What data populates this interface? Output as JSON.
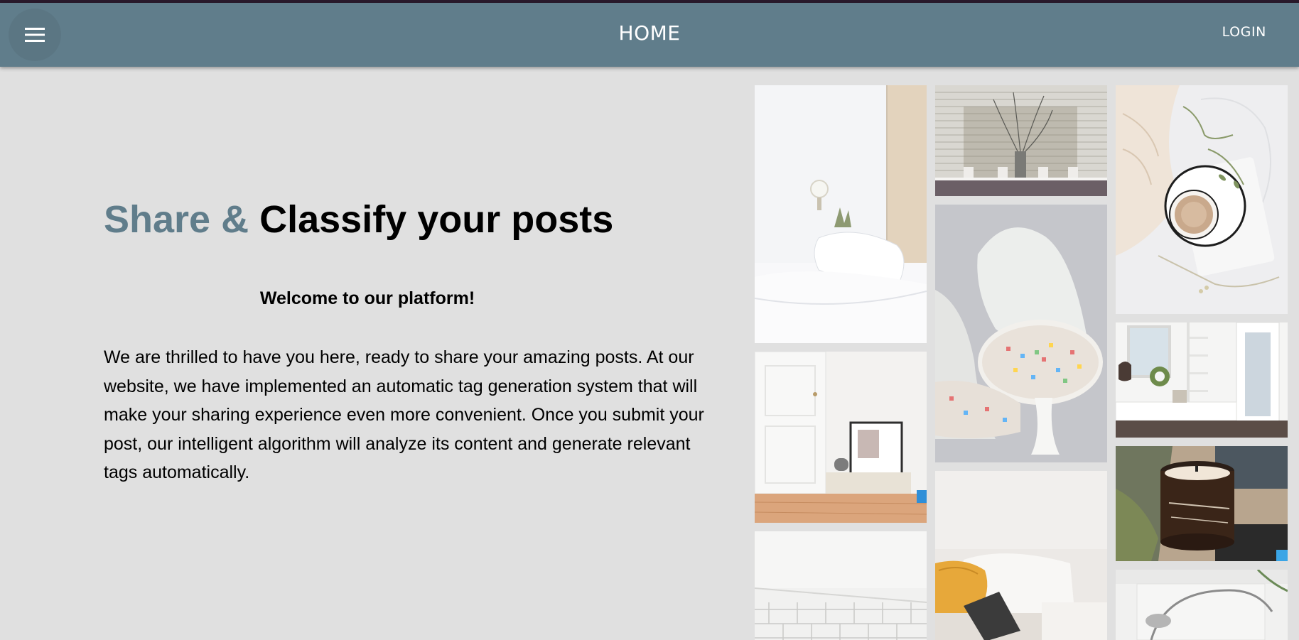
{
  "appbar": {
    "title": "HOME",
    "login_label": "LOGIN",
    "menu_icon": "menu-icon",
    "color": "#607d8b"
  },
  "hero": {
    "title_accent": "Share &",
    "title_rest": " Classify your posts",
    "accent_color": "#607d8b",
    "welcome": "Welcome to our platform!",
    "description": "We are thrilled to have you here, ready to share your amazing posts. At our website, we have implemented an automatic tag generation system that will make your sharing experience even more convenient. Once you submit your post, our intelligent algorithm will analyze its content and generate relevant tags automatically."
  },
  "gallery": {
    "images": [
      {
        "name": "bedroom-photo"
      },
      {
        "name": "window-vase-photo"
      },
      {
        "name": "coffee-bed-photo"
      },
      {
        "name": "tulip-chairs-photo"
      },
      {
        "name": "entryway-photo"
      },
      {
        "name": "books-floor-photo"
      },
      {
        "name": "candle-jar-photo"
      },
      {
        "name": "kitchen-tiles-photo"
      },
      {
        "name": "sofa-laptop-photo"
      },
      {
        "name": "arc-lamp-photo"
      }
    ]
  }
}
